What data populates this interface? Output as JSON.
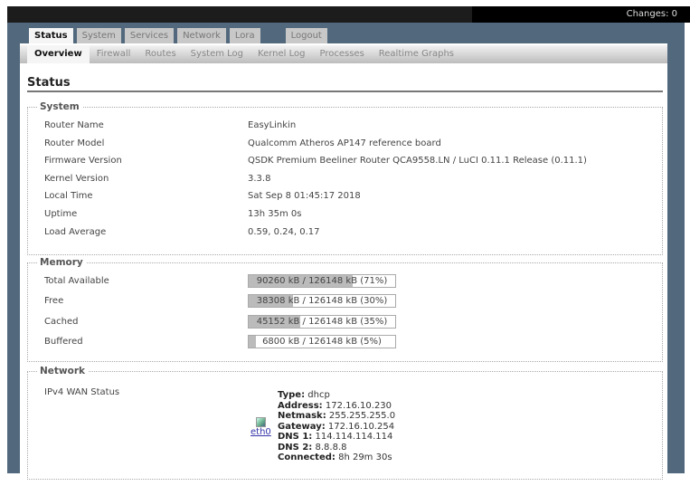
{
  "header": {
    "changes": "Changes: 0"
  },
  "tabs": [
    "Status",
    "System",
    "Services",
    "Network",
    "Lora",
    "Logout"
  ],
  "subtabs": [
    "Overview",
    "Firewall",
    "Routes",
    "System Log",
    "Kernel Log",
    "Processes",
    "Realtime Graphs"
  ],
  "page_title": "Status",
  "system": {
    "legend": "System",
    "rows": [
      {
        "label": "Router Name",
        "value": "EasyLinkin"
      },
      {
        "label": "Router Model",
        "value": "Qualcomm Atheros AP147 reference board"
      },
      {
        "label": "Firmware Version",
        "value": "QSDK Premium Beeliner Router QCA9558.LN / LuCI 0.11.1 Release (0.11.1)"
      },
      {
        "label": "Kernel Version",
        "value": "3.3.8"
      },
      {
        "label": "Local Time",
        "value": "Sat Sep 8 01:45:17 2018"
      },
      {
        "label": "Uptime",
        "value": "13h 35m 0s"
      },
      {
        "label": "Load Average",
        "value": "0.59, 0.24, 0.17"
      }
    ]
  },
  "memory": {
    "legend": "Memory",
    "rows": [
      {
        "label": "Total Available",
        "value": "90260 kB / 126148 kB (71%)",
        "percent": 71
      },
      {
        "label": "Free",
        "value": "38308 kB / 126148 kB (30%)",
        "percent": 30
      },
      {
        "label": "Cached",
        "value": "45152 kB / 126148 kB (35%)",
        "percent": 35
      },
      {
        "label": "Buffered",
        "value": "6800 kB / 126148 kB (5%)",
        "percent": 5
      }
    ]
  },
  "network": {
    "legend": "Network",
    "wan_label": "IPv4 WAN Status",
    "iface": "eth0",
    "fields": [
      {
        "k": "Type:",
        "v": "dhcp"
      },
      {
        "k": "Address:",
        "v": "172.16.10.230"
      },
      {
        "k": "Netmask:",
        "v": "255.255.255.0"
      },
      {
        "k": "Gateway:",
        "v": "172.16.10.254"
      },
      {
        "k": "DNS 1:",
        "v": "114.114.114.114"
      },
      {
        "k": "DNS 2:",
        "v": "8.8.8.8"
      },
      {
        "k": "Connected:",
        "v": "8h 29m 30s"
      }
    ]
  }
}
